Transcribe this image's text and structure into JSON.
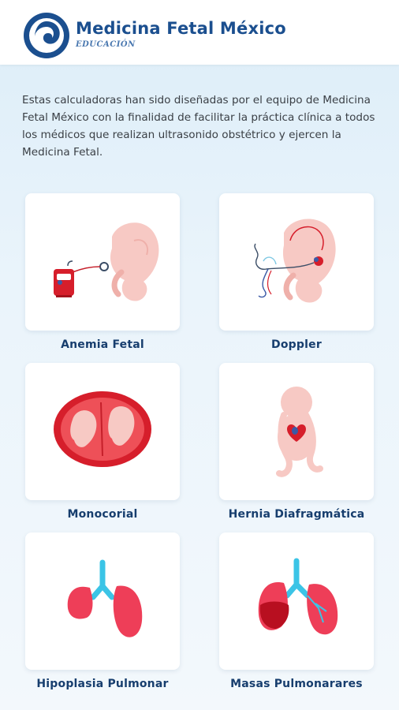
{
  "brand": {
    "title": "Medicina Fetal México",
    "subtitle": "EDUCACIÓN",
    "logo_icon": "swirl-logo-icon",
    "accent": "#1b4f8f"
  },
  "intro_text": "Estas calculadoras han sido diseñadas por el equipo de Medicina Fetal México con la finalidad de facilitar la práctica clínica a todos los médicos que realizan ultrasonido obstétrico y ejercen la Medicina Fetal.",
  "calculators": [
    {
      "label": "Anemia Fetal",
      "icon": "fetus-transfusion-icon"
    },
    {
      "label": "Doppler",
      "icon": "fetus-doppler-icon"
    },
    {
      "label": "Monocorial",
      "icon": "twin-placenta-icon"
    },
    {
      "label": "Hernia Diafragmática",
      "icon": "fetus-heart-icon"
    },
    {
      "label": "Hipoplasia Pulmonar",
      "icon": "lungs-icon"
    },
    {
      "label": "Masas Pulmonarares",
      "icon": "lungs-mass-icon"
    }
  ]
}
